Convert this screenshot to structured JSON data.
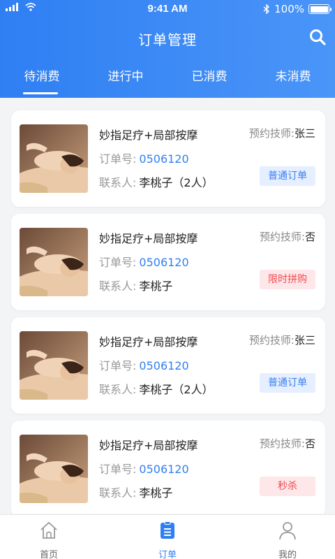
{
  "status_bar": {
    "time": "9:41 AM",
    "battery": "100%"
  },
  "header": {
    "title": "订单管理"
  },
  "tabs": [
    {
      "label": "待消费",
      "active": true
    },
    {
      "label": "进行中",
      "active": false
    },
    {
      "label": "已消费",
      "active": false
    },
    {
      "label": "未消费",
      "active": false
    }
  ],
  "labels": {
    "order_no": "订单号:",
    "contact": "联系人:",
    "tech": "预约技师:"
  },
  "orders": [
    {
      "service": "妙指足疗+局部按摩",
      "technician": "张三",
      "order_no": "0506120",
      "contact": "李桃子（2人）",
      "badge": "普通订单",
      "badge_type": "normal"
    },
    {
      "service": "妙指足疗+局部按摩",
      "technician": "否",
      "order_no": "0506120",
      "contact": "李桃子",
      "badge": "限时拼购",
      "badge_type": "red"
    },
    {
      "service": "妙指足疗+局部按摩",
      "technician": "张三",
      "order_no": "0506120",
      "contact": "李桃子（2人）",
      "badge": "普通订单",
      "badge_type": "normal"
    },
    {
      "service": "妙指足疗+局部按摩",
      "technician": "否",
      "order_no": "0506120",
      "contact": "李桃子",
      "badge": "秒杀",
      "badge_type": "red"
    }
  ],
  "bottom_nav": [
    {
      "label": "首页",
      "icon": "home-icon",
      "active": false
    },
    {
      "label": "订单",
      "icon": "order-list-icon",
      "active": true
    },
    {
      "label": "我的",
      "icon": "user-icon",
      "active": false
    }
  ],
  "colors": {
    "primary": "#2f7ff3",
    "badge_normal_bg": "#e5efff",
    "badge_red_bg": "#fde7e8",
    "badge_red_text": "#ee4b52"
  }
}
